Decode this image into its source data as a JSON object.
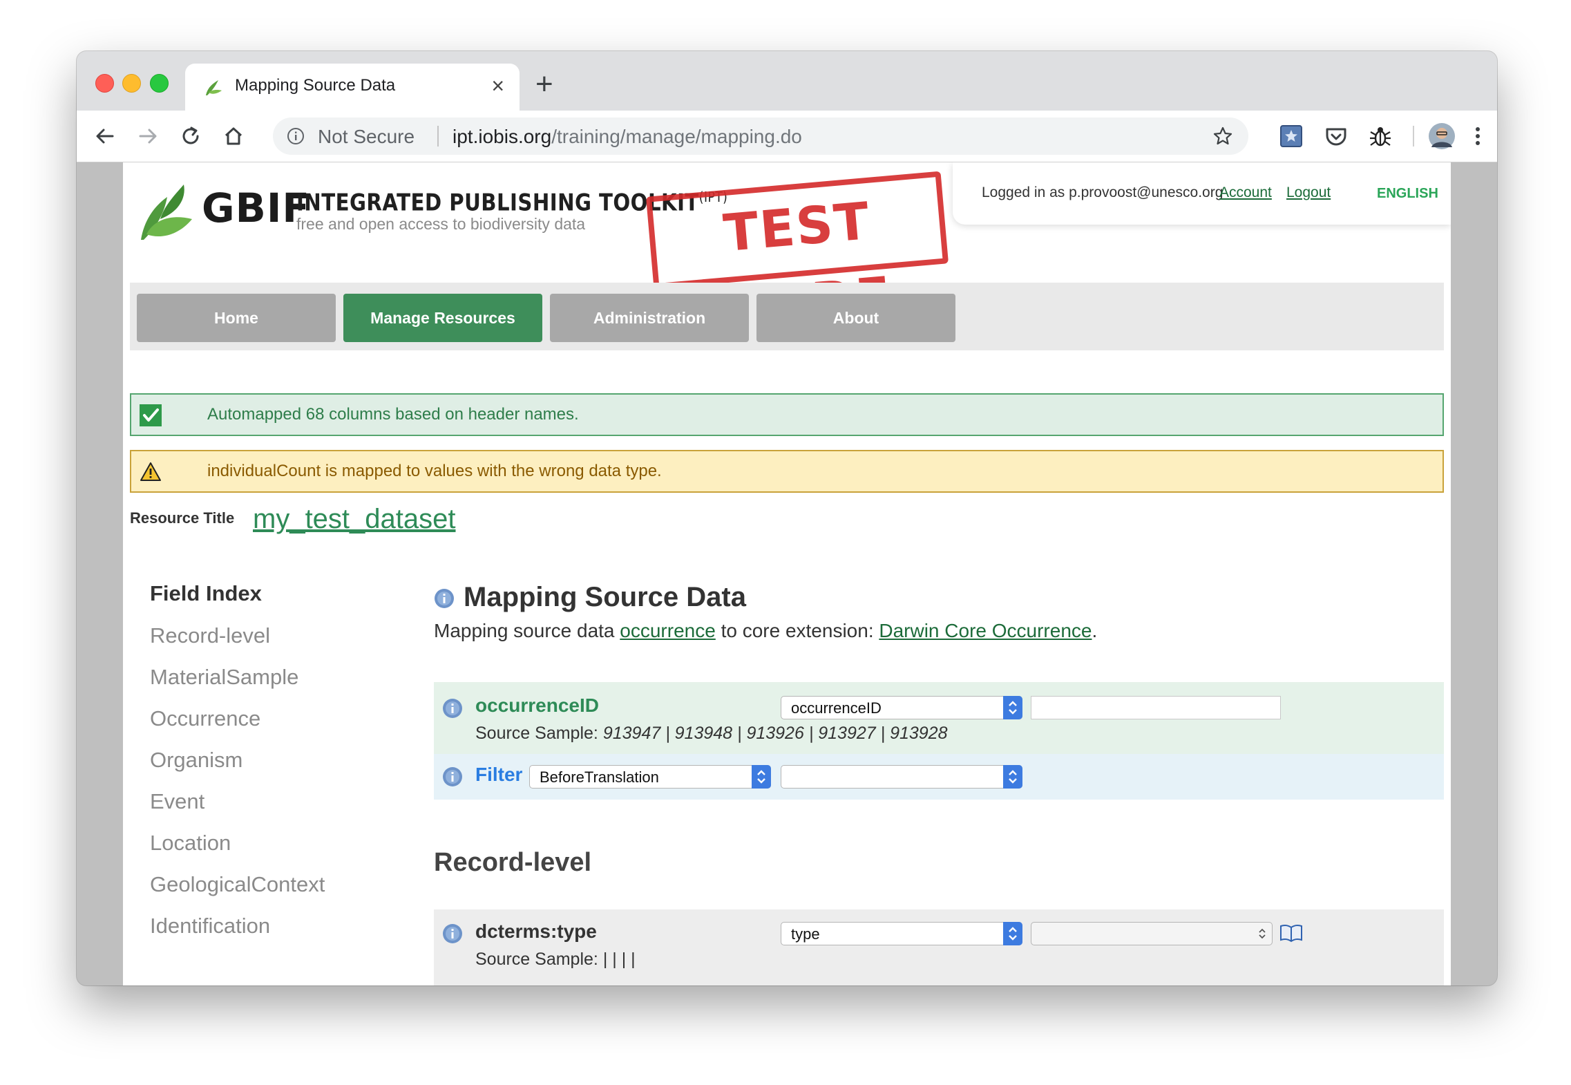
{
  "browser": {
    "tab_title": "Mapping Source Data",
    "tab_close": "×",
    "new_tab": "+",
    "security_label": "Not Secure",
    "url_host": "ipt.iobis.org",
    "url_path": "/training/manage/mapping.do"
  },
  "header": {
    "gbif": "GBIF",
    "toolkit_title": "INTEGRATED PUBLISHING TOOLKIT",
    "toolkit_abbr": "(IPT)",
    "subtitle": "free and open access to biodiversity data",
    "stamp": "TEST MODE",
    "logged_in": "Logged in as p.provoost@unesco.org",
    "account": "Account",
    "logout": "Logout",
    "language": "ENGLISH"
  },
  "nav": {
    "items": [
      {
        "label": "Home",
        "active": false
      },
      {
        "label": "Manage Resources",
        "active": true
      },
      {
        "label": "Administration",
        "active": false
      },
      {
        "label": "About",
        "active": false
      }
    ]
  },
  "messages": {
    "success": "Automapped 68 columns based on header names.",
    "warning": "individualCount is mapped to values with the wrong data type."
  },
  "resource": {
    "label": "Resource Title",
    "title": "my_test_dataset"
  },
  "field_index": {
    "title": "Field Index",
    "items": [
      "Record-level",
      "MaterialSample",
      "Occurrence",
      "Organism",
      "Event",
      "Location",
      "GeologicalContext",
      "Identification"
    ]
  },
  "mapping": {
    "title": "Mapping Source Data",
    "desc_prefix": "Mapping source data ",
    "desc_link1": "occurrence",
    "desc_middle": " to core extension: ",
    "desc_link2": "Darwin Core Occurrence",
    "desc_suffix": ".",
    "id_field": {
      "name": "occurrenceID",
      "source_label": "Source Sample: ",
      "source_values": "913947 | 913948 | 913926 | 913927 | 913928",
      "select_value": "occurrenceID"
    },
    "filter": {
      "label": "Filter",
      "select_value": "BeforeTranslation"
    },
    "record_level_title": "Record-level",
    "type_field": {
      "name": "dcterms:type",
      "source_label": "Source Sample:",
      "source_values": "|   |   |   |",
      "select_value": "type"
    }
  },
  "colors": {
    "brand_green": "#3e8e5a",
    "link_green": "#2e8b57",
    "warning_bg": "#fdefc0",
    "success_bg": "#dfeee5",
    "stamp_red": "#d42a2a"
  }
}
